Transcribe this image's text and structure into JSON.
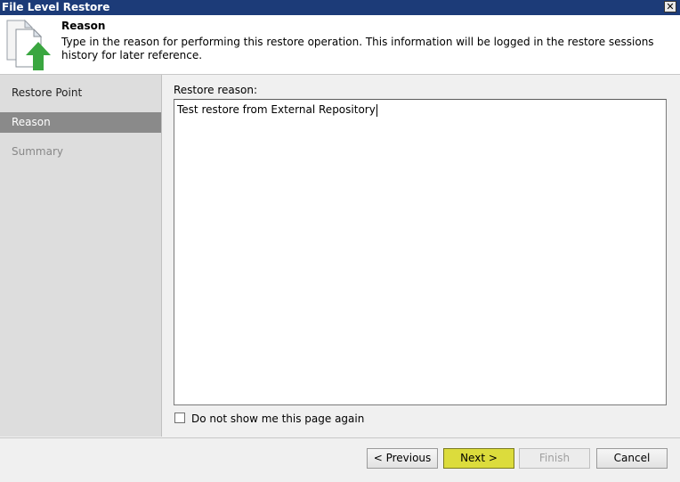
{
  "window": {
    "title": "File Level Restore",
    "close_glyph": "✕"
  },
  "header": {
    "icon": "restore-file-icon",
    "title": "Reason",
    "description": "Type in the reason for performing this restore operation. This information will be logged in the restore sessions history for later reference."
  },
  "steps": [
    {
      "label": "Restore Point",
      "state": "normal"
    },
    {
      "label": "Reason",
      "state": "active"
    },
    {
      "label": "Summary",
      "state": "disabled"
    }
  ],
  "form": {
    "reason_label": "Restore reason:",
    "reason_value": "Test restore from External Repository",
    "dont_show_label": "Do not show me this page again",
    "dont_show_checked": false
  },
  "buttons": {
    "previous": "< Previous",
    "next": "Next >",
    "finish": "Finish",
    "cancel": "Cancel"
  },
  "colors": {
    "titlebar": "#1c3b78",
    "active_step": "#8a8a8a",
    "primary_button": "#dcdc3c",
    "icon_arrow": "#3aa640"
  }
}
